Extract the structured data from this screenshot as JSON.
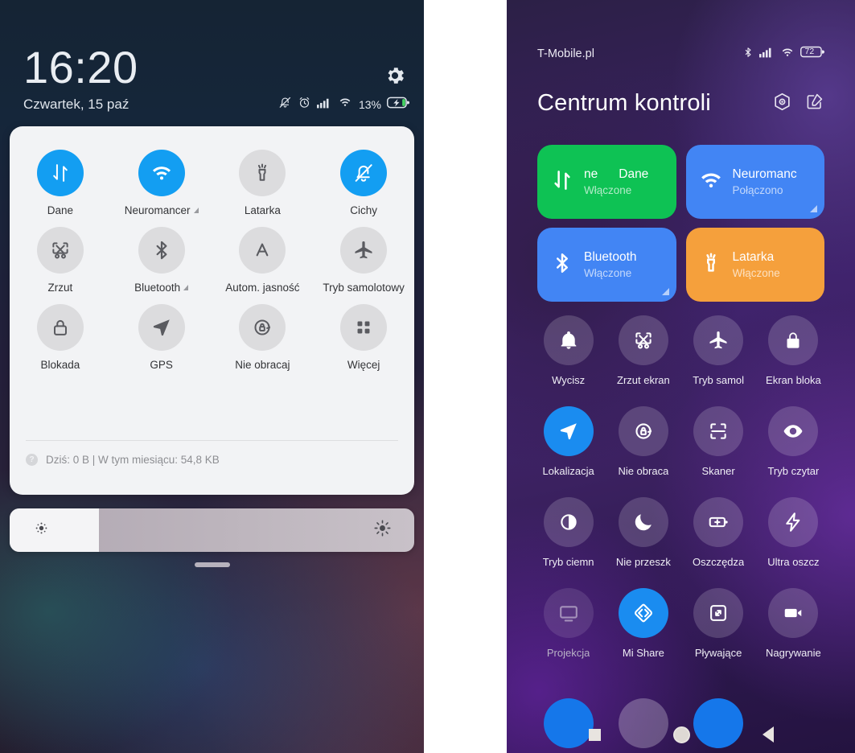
{
  "left_panel": {
    "status": {
      "clock": "16:20",
      "date": "Czwartek, 15 paź",
      "battery_percent": "13%",
      "icons": [
        "mute-bell-icon",
        "alarm-icon",
        "signal-icon",
        "wifi-icon",
        "battery-charging-icon"
      ],
      "gear": "settings-gear-icon"
    },
    "quick_settings": [
      {
        "label": "Dane",
        "icon": "data-transfer-icon",
        "active": true,
        "arrow": false
      },
      {
        "label": "Neuromancer",
        "icon": "wifi-icon",
        "active": true,
        "arrow": true
      },
      {
        "label": "Latarka",
        "icon": "flashlight-icon",
        "active": false,
        "arrow": false
      },
      {
        "label": "Cichy",
        "icon": "bell-mute-icon",
        "active": true,
        "arrow": false
      },
      {
        "label": "Zrzut",
        "icon": "screenshot-icon",
        "active": false,
        "arrow": false
      },
      {
        "label": "Bluetooth",
        "icon": "bluetooth-icon",
        "active": false,
        "arrow": true
      },
      {
        "label": "Autom. jasność",
        "icon": "auto-brightness-icon",
        "active": false,
        "arrow": false
      },
      {
        "label": "Tryb samolotowy",
        "icon": "airplane-icon",
        "active": false,
        "arrow": false
      },
      {
        "label": "Blokada",
        "icon": "lock-icon",
        "active": false,
        "arrow": false
      },
      {
        "label": "GPS",
        "icon": "location-arrow-icon",
        "active": false,
        "arrow": false
      },
      {
        "label": "Nie obracaj",
        "icon": "rotation-lock-icon",
        "active": false,
        "arrow": false
      },
      {
        "label": "Więcej",
        "icon": "grid-more-icon",
        "active": false,
        "arrow": false
      }
    ],
    "data_usage": "Dziś: 0 B | W tym miesiącu: 54,8 KB",
    "brightness": {
      "value_percent": 22,
      "low_icon": "brightness-low-icon",
      "high_icon": "brightness-high-icon"
    },
    "handle": "drag-handle"
  },
  "right_panel": {
    "status": {
      "carrier": "T-Mobile.pl",
      "battery_level": "72",
      "icons": [
        "bluetooth-icon",
        "signal-icon",
        "wifi-icon",
        "battery-icon"
      ]
    },
    "header": {
      "title": "Centrum kontroli",
      "actions": [
        {
          "name": "hex-settings-icon",
          "label": "Ustawienia"
        },
        {
          "name": "edit-icon",
          "label": "Edytuj"
        }
      ]
    },
    "cards": [
      {
        "title": "ne",
        "title2": "Dane",
        "subtitle": "Włączone",
        "icon": "data-transfer-icon",
        "color": "#0ec254",
        "marquee": true,
        "corner": false
      },
      {
        "title": "Neuromanc",
        "title2": "",
        "subtitle": "Połączono",
        "icon": "wifi-icon",
        "color": "#4285f4",
        "marquee": false,
        "corner": true
      },
      {
        "title": "Bluetooth",
        "title2": "",
        "subtitle": "Włączone",
        "icon": "bluetooth-icon",
        "color": "#4285f4",
        "marquee": false,
        "corner": true
      },
      {
        "title": "Latarka",
        "title2": "",
        "subtitle": "Włączone",
        "icon": "flashlight-icon",
        "color": "#f5a03c",
        "marquee": false,
        "corner": false
      }
    ],
    "toggles": [
      {
        "label": "Wycisz",
        "icon": "bell-icon",
        "active": false,
        "dim": false
      },
      {
        "label": "Zrzut ekran",
        "icon": "screenshot-icon",
        "active": false,
        "dim": false
      },
      {
        "label": "Tryb samol",
        "icon": "airplane-icon",
        "active": false,
        "dim": false
      },
      {
        "label": "Ekran bloka",
        "icon": "lock-icon",
        "active": false,
        "dim": false
      },
      {
        "label": "Lokalizacja",
        "icon": "location-arrow-icon",
        "active": true,
        "dim": false
      },
      {
        "label": "Nie obraca",
        "icon": "rotation-lock-icon",
        "active": false,
        "dim": false
      },
      {
        "label": "Skaner",
        "icon": "scanner-icon",
        "active": false,
        "dim": false
      },
      {
        "label": "Tryb czytar",
        "icon": "eye-icon",
        "active": false,
        "dim": false
      },
      {
        "label": "Tryb ciemn",
        "icon": "dark-mode-icon",
        "active": false,
        "dim": false
      },
      {
        "label": "Nie przeszk",
        "icon": "moon-icon",
        "active": false,
        "dim": false
      },
      {
        "label": "Oszczędza",
        "icon": "battery-saver-icon",
        "active": false,
        "dim": false
      },
      {
        "label": "Ultra oszcz",
        "icon": "ultra-saver-icon",
        "active": false,
        "dim": false
      },
      {
        "label": "Projekcja",
        "icon": "cast-screen-icon",
        "active": false,
        "dim": true
      },
      {
        "label": "Mi Share",
        "icon": "mi-share-icon",
        "active": true,
        "dim": false
      },
      {
        "label": "Pływające ",
        "icon": "floating-window-icon",
        "active": false,
        "dim": false
      },
      {
        "label": "Nagrywanie",
        "icon": "screen-record-icon",
        "active": false,
        "dim": false
      }
    ],
    "partial_row": [
      {
        "state": "on"
      },
      {
        "state": "off"
      },
      {
        "state": "on"
      },
      {
        "state": "none"
      }
    ],
    "navbar": [
      {
        "name": "recents-button",
        "shape": "square"
      },
      {
        "name": "home-button",
        "shape": "circle"
      },
      {
        "name": "back-button",
        "shape": "triangle"
      }
    ]
  },
  "colors": {
    "accent_blue": "#139ef2",
    "card_green": "#0ec254",
    "card_blue": "#4285f4",
    "card_orange": "#f5a03c",
    "panel_card_bg": "#f2f3f5"
  }
}
